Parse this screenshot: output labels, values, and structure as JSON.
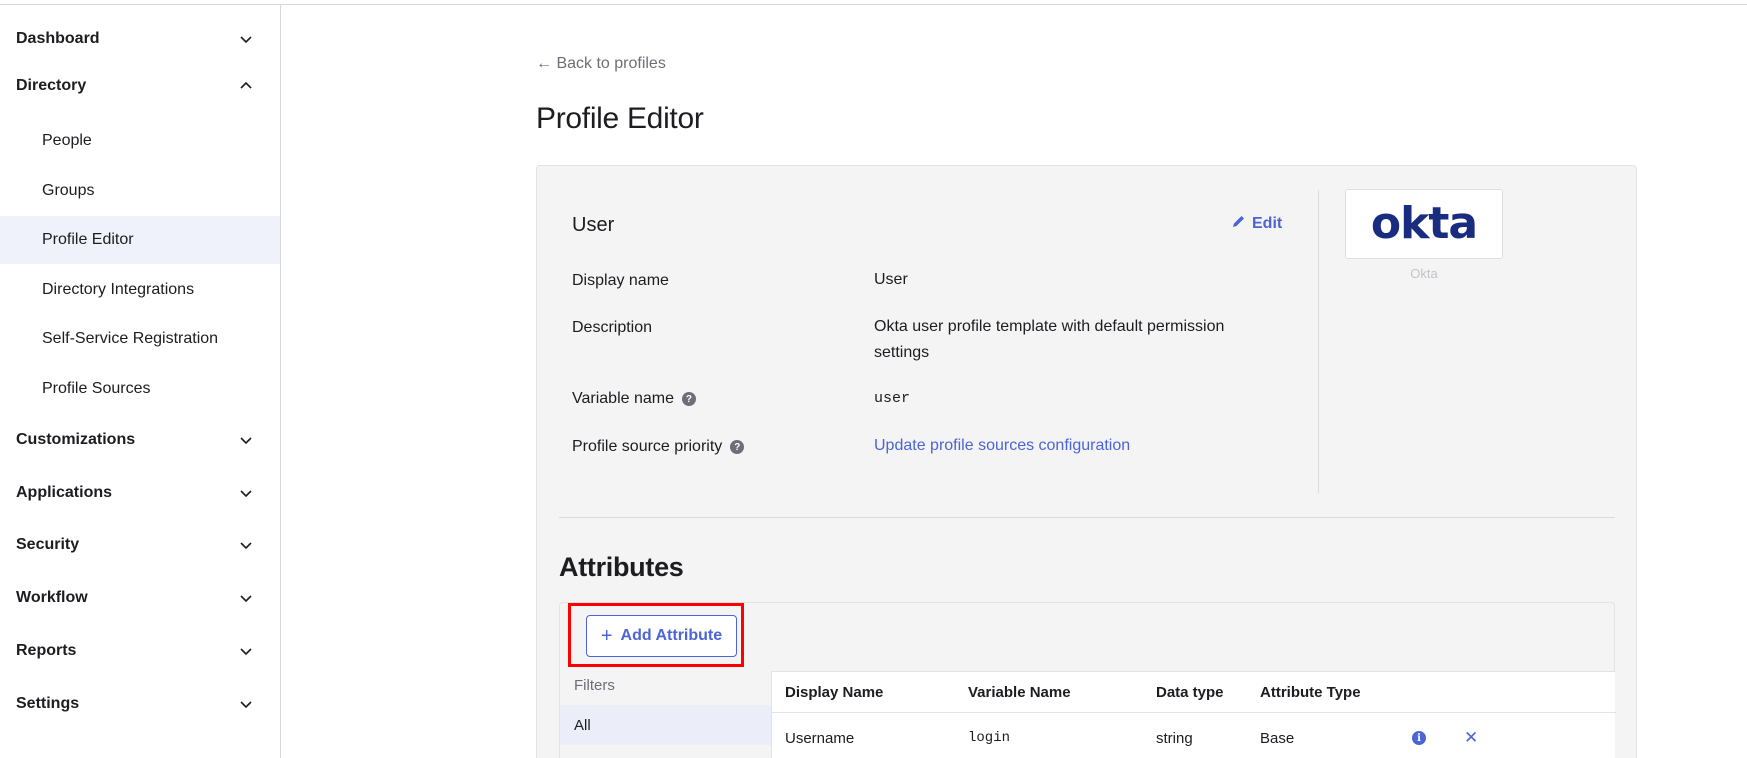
{
  "sidebar": {
    "sections": [
      {
        "label": "Dashboard",
        "expanded": false
      },
      {
        "label": "Directory",
        "expanded": true
      },
      {
        "label": "Customizations",
        "expanded": false
      },
      {
        "label": "Applications",
        "expanded": false
      },
      {
        "label": "Security",
        "expanded": false
      },
      {
        "label": "Workflow",
        "expanded": false
      },
      {
        "label": "Reports",
        "expanded": false
      },
      {
        "label": "Settings",
        "expanded": false
      }
    ],
    "directory_items": [
      {
        "label": "People",
        "active": false
      },
      {
        "label": "Groups",
        "active": false
      },
      {
        "label": "Profile Editor",
        "active": true
      },
      {
        "label": "Directory Integrations",
        "active": false
      },
      {
        "label": "Self-Service Registration",
        "active": false
      },
      {
        "label": "Profile Sources",
        "active": false
      }
    ]
  },
  "main": {
    "back_link": "← Back to profiles",
    "page_title": "Profile Editor",
    "profile": {
      "title": "User",
      "edit_label": "Edit",
      "fields": [
        {
          "label": "Display name",
          "value": "User"
        },
        {
          "label": "Description",
          "value": "Okta user profile template with default permission settings"
        },
        {
          "label": "Variable name",
          "value": "user"
        },
        {
          "label": "Profile source priority",
          "value": "Update profile sources configuration"
        }
      ],
      "logo_text": "okta",
      "logo_caption": "Okta"
    },
    "attributes": {
      "title": "Attributes",
      "add_button": "Add Attribute",
      "filters_title": "Filters",
      "filter_selected": "All",
      "columns": [
        "Display Name",
        "Variable Name",
        "Data type",
        "Attribute Type"
      ],
      "rows": [
        {
          "display_name": "Username",
          "variable_name": "login",
          "data_type": "string",
          "attribute_type": "Base"
        }
      ]
    }
  },
  "colors": {
    "accent": "#4c64d6",
    "highlight": "#ff0000",
    "active_nav_bg": "#f0f2fb",
    "okta_brand": "#192c80"
  }
}
